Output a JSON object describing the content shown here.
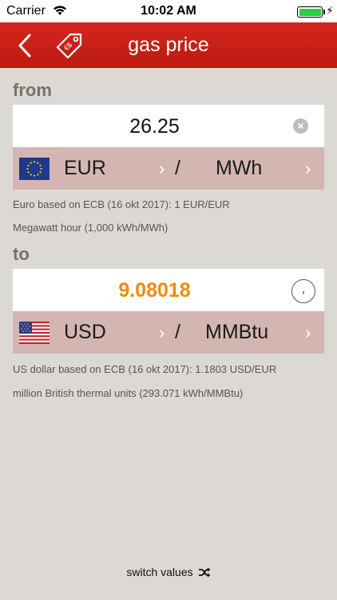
{
  "status_bar": {
    "carrier": "Carrier",
    "time": "10:02 AM"
  },
  "nav": {
    "title": "gas price"
  },
  "from": {
    "label": "from",
    "value": "26.25",
    "currency": "EUR",
    "slash": "/",
    "unit": "MWh",
    "currency_info": "Euro based on ECB (16 okt 2017): 1 EUR/EUR",
    "unit_info": "Megawatt hour (1,000 kWh/MWh)"
  },
  "to": {
    "label": "to",
    "value": "9.08018",
    "comma": ",",
    "currency": "USD",
    "slash": "/",
    "unit": "MMBtu",
    "currency_info": "US dollar based on ECB (16 okt 2017): 1.1803 USD/EUR",
    "unit_info": "million British thermal units (293.071 kWh/MMBtu)"
  },
  "switch_label": "switch values",
  "colors": {
    "nav": "#c8201a",
    "result": "#f08a0c",
    "unit_row": "#d3b6b2",
    "background": "#dcd8d4"
  }
}
